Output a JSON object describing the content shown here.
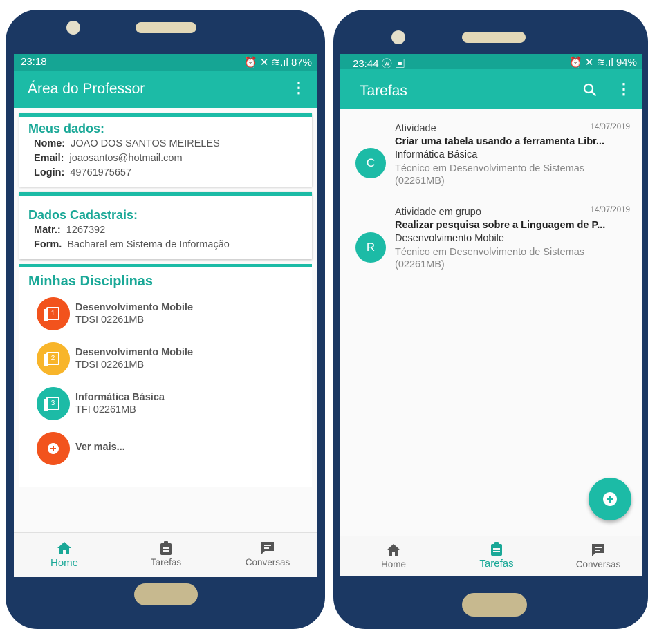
{
  "left_phone": {
    "status": {
      "time": "23:18",
      "icons": "⏰ ✕ ≋.ıl 87%"
    },
    "appbar": {
      "title": "Área do Professor",
      "menu_icon": "more-vert-icon"
    },
    "meus_dados": {
      "heading": "Meus dados:",
      "rows": [
        {
          "label": "Nome:",
          "value": "JOAO DOS SANTOS MEIRELES"
        },
        {
          "label": "Email:",
          "value": "joaosantos@hotmail.com"
        },
        {
          "label": "Login:",
          "value": "49761975657"
        }
      ]
    },
    "dados_cadastrais": {
      "heading": "Dados Cadastrais:",
      "rows": [
        {
          "label": "Matr.:",
          "value": "1267392"
        },
        {
          "label": "Form.",
          "value": "Bacharel em Sistema de Informação"
        }
      ]
    },
    "disciplinas": {
      "heading": "Minhas Disciplinas",
      "items": [
        {
          "title": "Desenvolvimento Mobile",
          "code": "TDSI 02261MB",
          "num": "1",
          "color": "#f2531d"
        },
        {
          "title": "Desenvolvimento Mobile",
          "code": "TDSI 02261MB",
          "num": "2",
          "color": "#f8b52a"
        },
        {
          "title": "Informática Básica",
          "code": "TFI 02261MB",
          "num": "3",
          "color": "#1cbba6"
        }
      ],
      "more": {
        "label": "Ver mais...",
        "color": "#f2531d"
      }
    },
    "nav": [
      {
        "label": "Home",
        "icon": "home-icon",
        "active": true
      },
      {
        "label": "Tarefas",
        "icon": "clipboard-icon",
        "active": false
      },
      {
        "label": "Conversas",
        "icon": "chat-icon",
        "active": false
      }
    ]
  },
  "right_phone": {
    "status": {
      "time": "23:44 ⓦ ▣",
      "icons": "⏰ ✕ ≋.ıl 94%"
    },
    "appbar": {
      "title": "Tarefas",
      "search_icon": "search-icon",
      "menu_icon": "more-vert-icon"
    },
    "tasks": [
      {
        "avatar": "C",
        "type": "Atividade",
        "date": "14/07/2019",
        "title": "Criar uma tabela usando a ferramenta Libr...",
        "subject": "Informática Básica",
        "course": "Técnico em Desenvolvimento de Sistemas",
        "code": "(02261MB)"
      },
      {
        "avatar": "R",
        "type": "Atividade em grupo",
        "date": "14/07/2019",
        "title": "Realizar pesquisa sobre a Linguagem de P...",
        "subject": "Desenvolvimento Mobile",
        "course": "Técnico em Desenvolvimento de Sistemas",
        "code": "(02261MB)"
      }
    ],
    "fab_icon": "add-icon",
    "nav": [
      {
        "label": "Home",
        "icon": "home-icon",
        "active": false
      },
      {
        "label": "Tarefas",
        "icon": "clipboard-icon",
        "active": true
      },
      {
        "label": "Conversas",
        "icon": "chat-icon",
        "active": false
      }
    ]
  },
  "colors": {
    "primary": "#1cbba6",
    "primary_dark": "#15a594",
    "frame": "#1b3863",
    "accent_orange": "#f2531d",
    "accent_yellow": "#f8b52a"
  }
}
